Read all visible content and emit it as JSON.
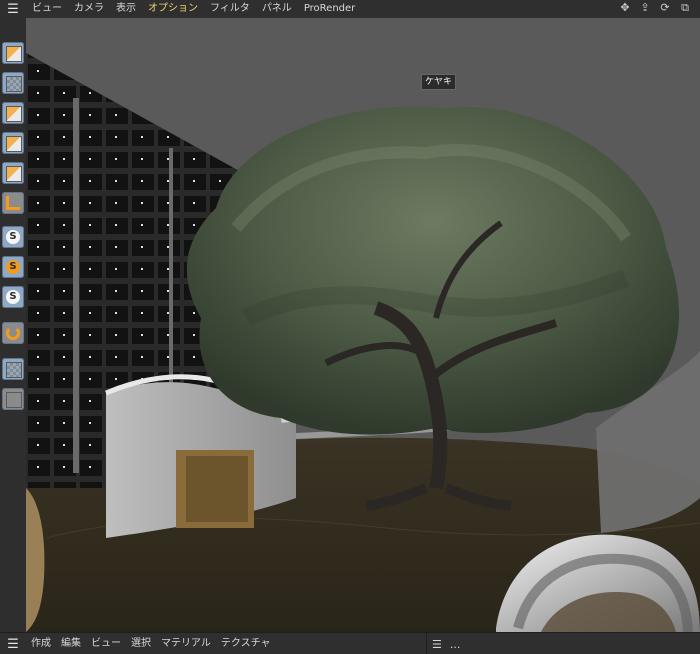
{
  "menubar": {
    "items": [
      {
        "label": "ビュー"
      },
      {
        "label": "カメラ"
      },
      {
        "label": "表示"
      },
      {
        "label": "オプション"
      },
      {
        "label": "フィルタ"
      },
      {
        "label": "パネル"
      },
      {
        "label": "ProRender"
      }
    ],
    "nav_icons": [
      "move-icon",
      "up-icon",
      "rotate-icon",
      "maximize-icon"
    ]
  },
  "viewport": {
    "object_tag": "ケヤキ"
  },
  "toolbar": {
    "tools": [
      "cube-icon",
      "checker-cube-icon",
      "vertex-cube-icon",
      "edge-cube-icon",
      "face-cube-icon",
      "axis-icon",
      "spline-white-icon",
      "spline-orange-icon",
      "spline-white-icon-2",
      "magnet-icon",
      "snap-grid-icon",
      "wireframe-grid-icon"
    ]
  },
  "bottombar": {
    "items": [
      {
        "label": "作成"
      },
      {
        "label": "編集"
      },
      {
        "label": "ビュー"
      },
      {
        "label": "選択"
      },
      {
        "label": "マテリアル"
      },
      {
        "label": "テクスチャ"
      }
    ],
    "right_label": "..."
  }
}
